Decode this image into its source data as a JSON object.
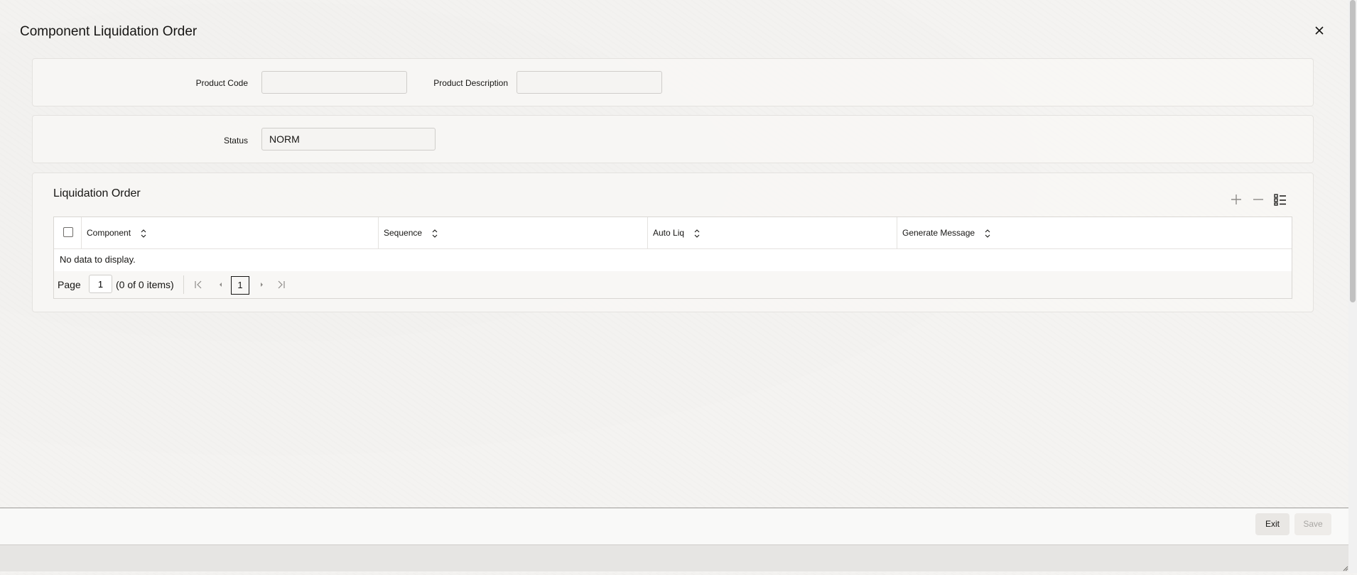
{
  "dialog": {
    "title": "Component Liquidation Order",
    "close_icon": "close-icon"
  },
  "product": {
    "code_label": "Product Code",
    "code_value": "",
    "description_label": "Product Description",
    "description_value": ""
  },
  "status": {
    "label": "Status",
    "value": "NORM"
  },
  "liquidation_order": {
    "title": "Liquidation Order",
    "toolbar_icons": [
      "add-icon",
      "remove-icon",
      "single-record-view-icon"
    ],
    "columns": [
      "Component",
      "Sequence",
      "Auto Liq",
      "Generate Message"
    ],
    "rows": [],
    "empty_text": "No data to display.",
    "pagination": {
      "page_label": "Page",
      "page_value": "1",
      "count_text": "(0 of 0 items)",
      "current_page": "1"
    }
  },
  "footer": {
    "exit_label": "Exit",
    "save_label": "Save"
  },
  "colors": {
    "background": "#f4f3f1",
    "panel": "#f8f7f5",
    "text": "#161513",
    "disabled_text": "#a8a6a3"
  }
}
